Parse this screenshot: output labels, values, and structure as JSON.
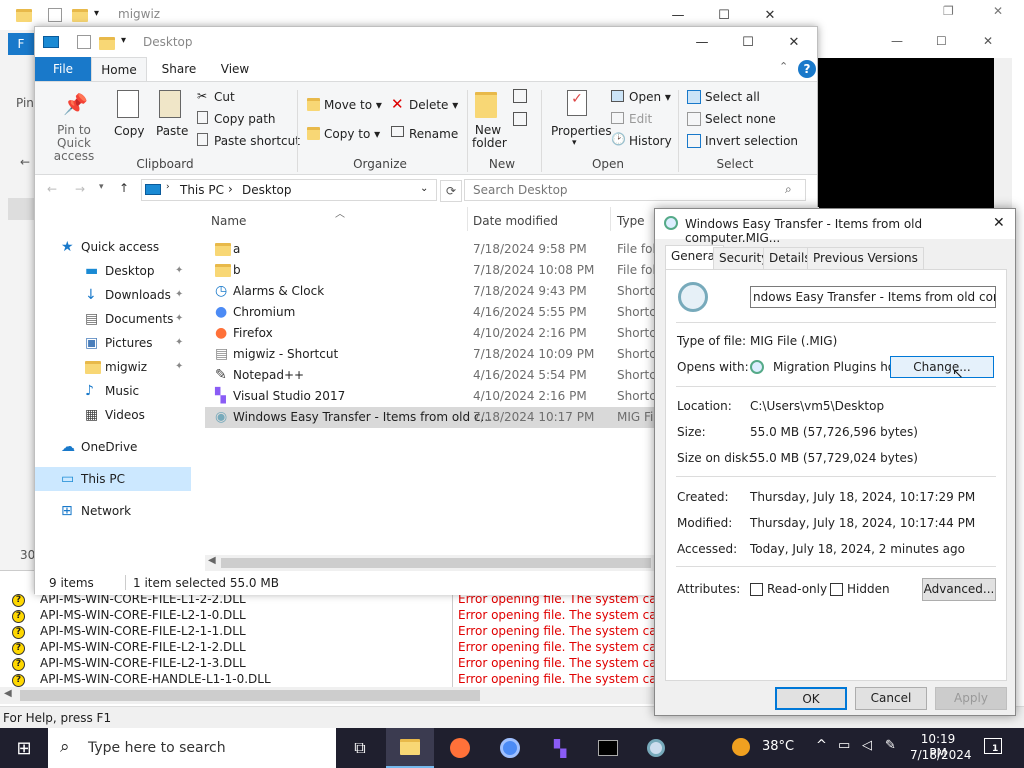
{
  "back_window": {
    "title": "migwiz"
  },
  "left_strip": {
    "f_tab": "F",
    "pin_label": "Pin",
    "count": "30"
  },
  "explorer": {
    "title": "Desktop",
    "tabs": [
      "File",
      "Home",
      "Share",
      "View"
    ],
    "ribbon": {
      "pin_quick_access": "Pin to Quick access",
      "copy": "Copy",
      "paste": "Paste",
      "cut": "Cut",
      "copy_path": "Copy path",
      "paste_shortcut": "Paste shortcut",
      "clipboard": "Clipboard",
      "move_to": "Move to",
      "copy_to": "Copy to",
      "delete": "Delete",
      "rename": "Rename",
      "organize": "Organize",
      "new_folder": "New folder",
      "new": "New",
      "properties": "Properties",
      "open": "Open",
      "edit": "Edit",
      "history": "History",
      "open_group": "Open",
      "select_all": "Select all",
      "select_none": "Select none",
      "invert_selection": "Invert selection",
      "select": "Select"
    },
    "address": {
      "this_pc": "This PC",
      "desktop": "Desktop"
    },
    "search_placeholder": "Search Desktop",
    "nav": {
      "quick_access": "Quick access",
      "desktop": "Desktop",
      "downloads": "Downloads",
      "documents": "Documents",
      "pictures": "Pictures",
      "migwiz": "migwiz",
      "music": "Music",
      "videos": "Videos",
      "onedrive": "OneDrive",
      "this_pc": "This PC",
      "network": "Network"
    },
    "columns": {
      "name": "Name",
      "date": "Date modified",
      "type": "Type"
    },
    "files": [
      {
        "name": "a",
        "date": "7/18/2024 9:58 PM",
        "type": "File fold"
      },
      {
        "name": "b",
        "date": "7/18/2024 10:08 PM",
        "type": "File fold"
      },
      {
        "name": "Alarms & Clock",
        "date": "7/18/2024 9:43 PM",
        "type": "Shortcut"
      },
      {
        "name": "Chromium",
        "date": "4/16/2024 5:55 PM",
        "type": "Shortcut"
      },
      {
        "name": "Firefox",
        "date": "4/10/2024 2:16 PM",
        "type": "Shortcut"
      },
      {
        "name": "migwiz - Shortcut",
        "date": "7/18/2024 10:09 PM",
        "type": "Shortcut"
      },
      {
        "name": "Notepad++",
        "date": "4/16/2024 5:54 PM",
        "type": "Shortcut"
      },
      {
        "name": "Visual Studio 2017",
        "date": "4/10/2024 2:16 PM",
        "type": "Shortcut"
      },
      {
        "name": "Windows Easy Transfer - Items from old c...",
        "date": "7/18/2024 10:17 PM",
        "type": "MIG File"
      }
    ],
    "status": {
      "items": "9 items",
      "selected": "1 item selected  55.0 MB"
    }
  },
  "bottom_list": {
    "dlls": [
      "API-MS-WIN-CORE-FILE-L1-2-2.DLL",
      "API-MS-WIN-CORE-FILE-L2-1-0.DLL",
      "API-MS-WIN-CORE-FILE-L2-1-1.DLL",
      "API-MS-WIN-CORE-FILE-L2-1-2.DLL",
      "API-MS-WIN-CORE-FILE-L2-1-3.DLL",
      "API-MS-WIN-CORE-HANDLE-L1-1-0.DLL"
    ],
    "error": "Error opening file. The system cannot"
  },
  "status_bar": "For Help, press F1",
  "props": {
    "title": "Windows Easy Transfer - Items from old computer.MIG...",
    "tabs": [
      "General",
      "Security",
      "Details",
      "Previous Versions"
    ],
    "filename": "ndows Easy Transfer - Items from old computer.MIG",
    "type_label": "Type of file:",
    "type_value": "MIG File (.MIG)",
    "opens_label": "Opens with:",
    "opens_value": "Migration Plugins host p",
    "change": "Change...",
    "location_label": "Location:",
    "location_value": "C:\\Users\\vm5\\Desktop",
    "size_label": "Size:",
    "size_value": "55.0 MB (57,726,596 bytes)",
    "disk_label": "Size on disk:",
    "disk_value": "55.0 MB (57,729,024 bytes)",
    "created_label": "Created:",
    "created_value": "Thursday, July 18, 2024, 10:17:29 PM",
    "modified_label": "Modified:",
    "modified_value": "Thursday, July 18, 2024, 10:17:44 PM",
    "accessed_label": "Accessed:",
    "accessed_value": "Today, July 18, 2024, 2 minutes ago",
    "attributes_label": "Attributes:",
    "readonly": "Read-only",
    "hidden": "Hidden",
    "advanced": "Advanced...",
    "ok": "OK",
    "cancel": "Cancel",
    "apply": "Apply"
  },
  "taskbar": {
    "search_placeholder": "Type here to search",
    "temp": "38°C",
    "time": "10:19 PM",
    "date": "7/18/2024",
    "notif_count": "1"
  }
}
